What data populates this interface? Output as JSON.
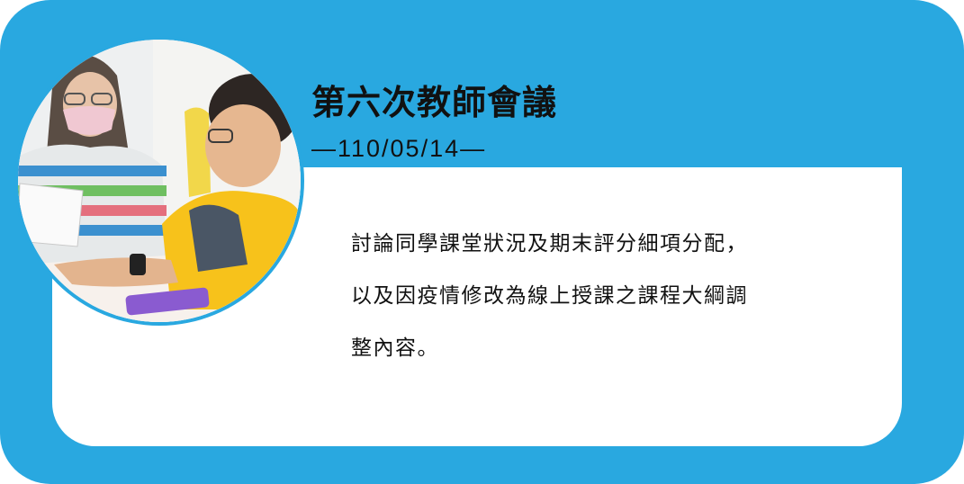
{
  "meeting": {
    "title": "第六次教師會議",
    "date": "—110/05/14—"
  },
  "description": {
    "lines": [
      "討論同學課堂狀況及期末評分細項分配，",
      "以及因疫情修改為線上授課之課程大綱調",
      "整內容。"
    ]
  },
  "colors": {
    "frame": "#29a8e0",
    "panel": "#ffffff",
    "text": "#111111"
  },
  "photo": {
    "icon": "meeting-photo"
  }
}
